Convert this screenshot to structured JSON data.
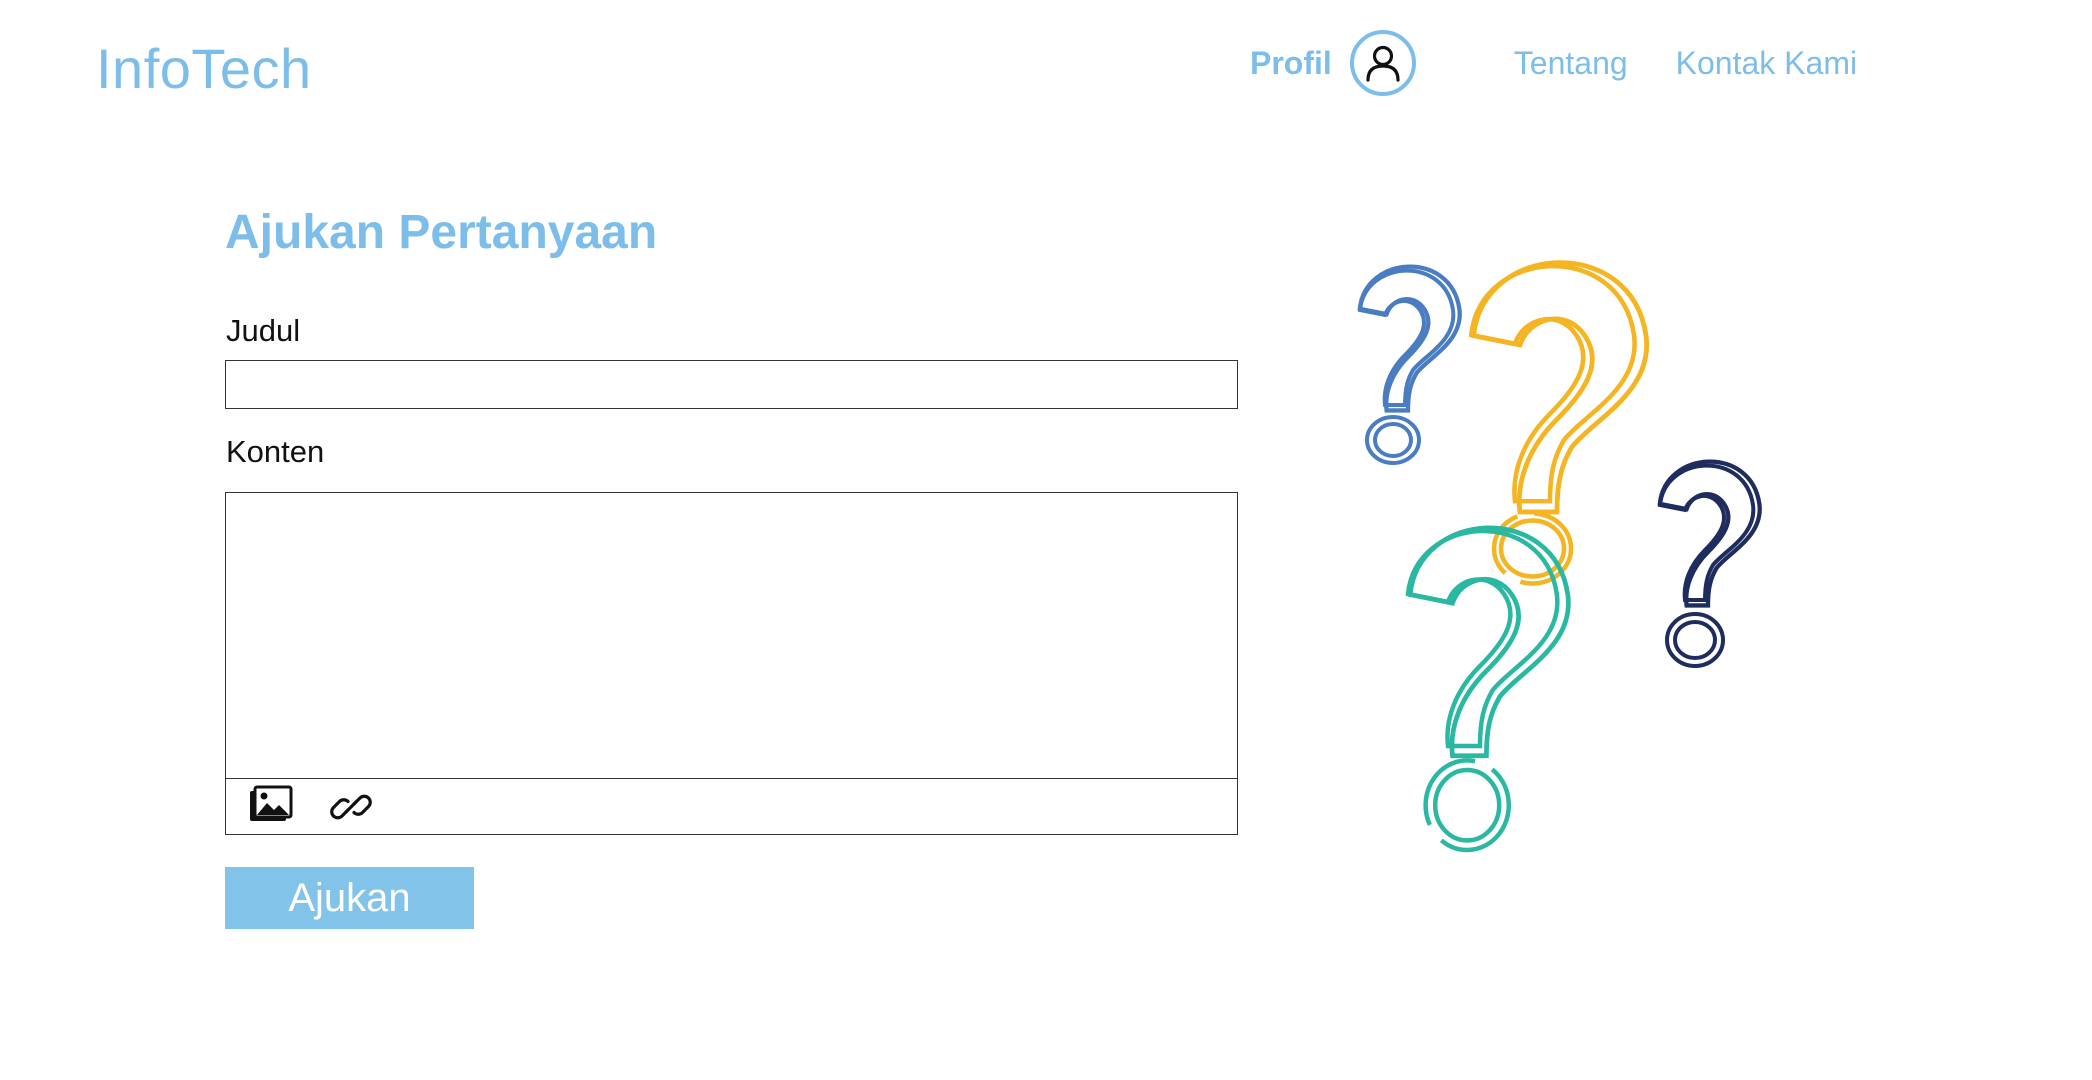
{
  "header": {
    "brand": "InfoTech",
    "nav": {
      "profile_label": "Profil",
      "about_label": "Tentang",
      "contact_label": "Kontak Kami"
    }
  },
  "form": {
    "title": "Ajukan Pertanyaan",
    "title_field": {
      "label": "Judul",
      "value": "",
      "placeholder": ""
    },
    "content_field": {
      "label": "Konten",
      "value": "",
      "placeholder": ""
    },
    "toolbar": {
      "icons": [
        "image-icon",
        "link-icon"
      ]
    },
    "submit_label": "Ajukan"
  },
  "illustration": {
    "icon": "question-marks-illustration",
    "colors": [
      "#f5b421",
      "#4a7cc2",
      "#1f2d5e",
      "#2bb8a3"
    ]
  },
  "colors": {
    "accent": "#7dbde9",
    "button": "#82c3ea",
    "border": "#333333"
  }
}
